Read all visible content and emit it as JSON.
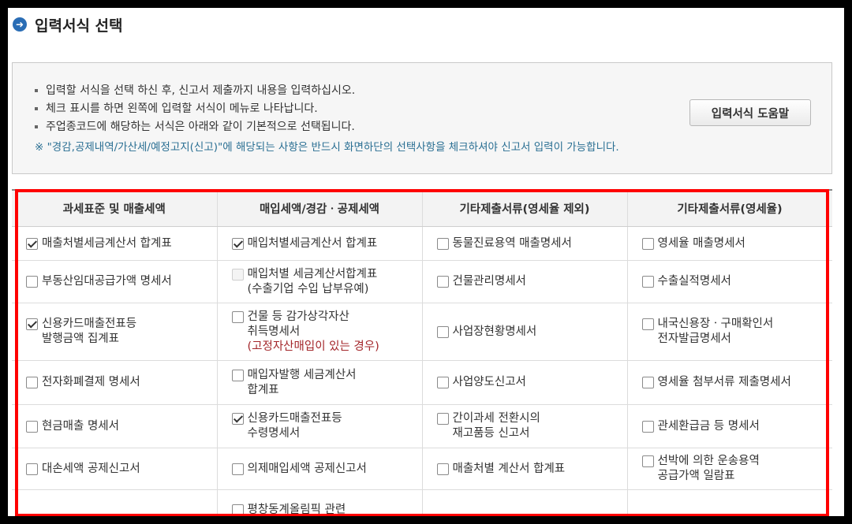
{
  "header": {
    "title": "입력서식 선택",
    "icon": "arrow-right-circle-icon"
  },
  "info": {
    "bullets": [
      "입력할 서식을 선택 하신 후, 신고서 제출까지 내용을 입력하십시오.",
      "체크 표시를 하면 왼쪽에 입력할 서식이 메뉴로 나타납니다.",
      "주업종코드에 해당하는 서식은 아래와 같이 기본적으로 선택됩니다."
    ],
    "note": "※ \"경감,공제내역/가산세/예정고지(신고)\"에 해당되는 사항은 반드시 화면하단의 선택사항을 체크하셔야 신고서 입력이 가능합니다.",
    "help_button": "입력서식 도움말"
  },
  "table": {
    "headers": [
      "과세표준 및 매출세액",
      "매입세액/경감ㆍ공제세액",
      "기타제출서류(영세율 제외)",
      "기타제출서류(영세율)"
    ],
    "rows": [
      [
        {
          "text": "매출처별세금계산서 합계표",
          "checked": true
        },
        {
          "text": "매입처별세금계산서 합계표",
          "checked": true
        },
        {
          "text": "동물진료용역 매출명세서",
          "checked": false
        },
        {
          "text": "영세율 매출명세서",
          "checked": false
        }
      ],
      [
        {
          "text": "부동산임대공급가액 명세서",
          "checked": false
        },
        {
          "text": "매입처별 세금계산서합계표",
          "sub": "(수출기업 수입 납부유예)",
          "checked": false,
          "disabled": true
        },
        {
          "text": "건물관리명세서",
          "checked": false
        },
        {
          "text": "수출실적명세서",
          "checked": false
        }
      ],
      [
        {
          "text": "신용카드매출전표등",
          "sub": "발행금액 집계표",
          "checked": true
        },
        {
          "text": "건물 등 감가상각자산",
          "sub": "취득명세서",
          "warn": "(고정자산매입이 있는 경우)",
          "checked": false
        },
        {
          "text": "사업장현황명세서",
          "checked": false
        },
        {
          "text": "내국신용장ㆍ구매확인서",
          "sub": "전자발급명세서",
          "checked": false
        }
      ],
      [
        {
          "text": "전자화폐결제 명세서",
          "checked": false
        },
        {
          "text": "매입자발행 세금계산서",
          "sub": "합계표",
          "checked": false
        },
        {
          "text": "사업양도신고서",
          "checked": false
        },
        {
          "text": "영세율 첨부서류 제출명세서",
          "checked": false
        }
      ],
      [
        {
          "text": "현금매출 명세서",
          "checked": false
        },
        {
          "text": "신용카드매출전표등",
          "sub": "수령명세서",
          "checked": true
        },
        {
          "text": "간이과세 전환시의",
          "sub": "재고품등 신고서",
          "checked": false
        },
        {
          "text": "관세환급금 등 명세서",
          "checked": false
        }
      ],
      [
        {
          "text": "대손세액 공제신고서",
          "checked": false
        },
        {
          "text": "의제매입세액 공제신고서",
          "checked": false
        },
        {
          "text": "매출처별 계산서 합계표",
          "checked": false
        },
        {
          "text": "선박에 의한 운송용역",
          "sub": "공급가액 일람표",
          "checked": false
        }
      ],
      [
        null,
        {
          "text": "평창동계올림픽 관련",
          "checked": false
        },
        null,
        null
      ]
    ]
  },
  "colors": {
    "highlight_border": "#ff0000",
    "accent": "#2a6db5",
    "warn_text": "#a3262a",
    "note_text": "#2a6f93"
  }
}
